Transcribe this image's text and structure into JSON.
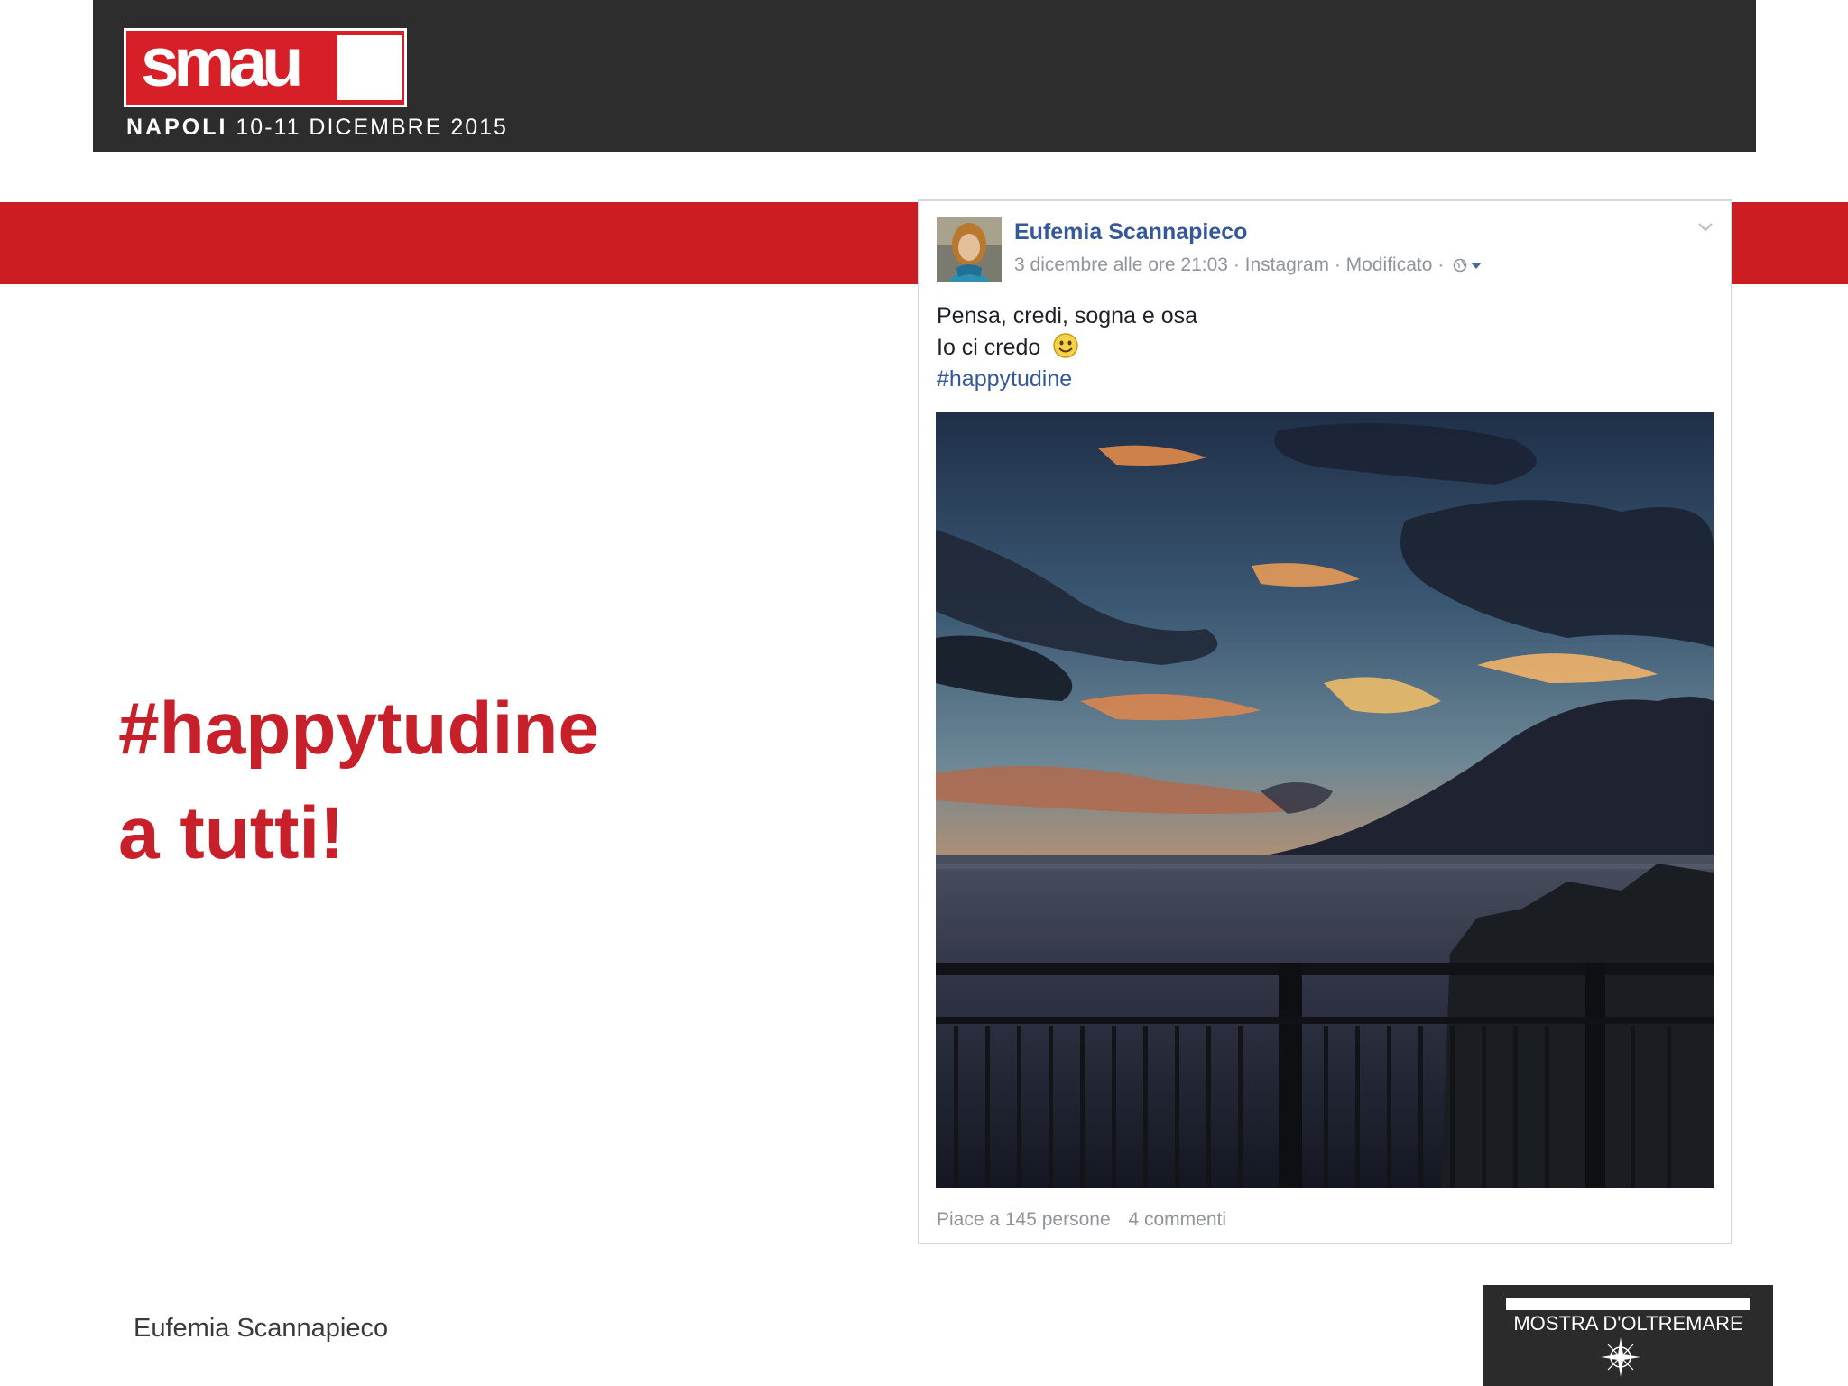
{
  "header": {
    "logo_text": "smau",
    "event_city": "NAPOLI",
    "event_dates": "10-11 DICEMBRE 2015"
  },
  "slide": {
    "title_line1": "#happytudine",
    "title_line2": "a tutti!",
    "footer_author": "Eufemia Scannapieco"
  },
  "post": {
    "author": "Eufemia Scannapieco",
    "meta": "3 dicembre alle ore 21:03 · Instagram · Modificato ·",
    "lines": [
      "Pensa, credi, sogna e osa",
      "Io ci credo"
    ],
    "hashtag": "#happytudine",
    "likes": "Piace a 145 persone",
    "comments": "4 commenti"
  },
  "venue_logo": {
    "text": "MOSTRA D'OLTREMARE"
  },
  "colors": {
    "header_bg": "#2d2d2e",
    "brand_red": "#cc1e22",
    "title_red": "#c8202a",
    "facebook_blue": "#365899",
    "meta_gray": "#90949c"
  },
  "icons": [
    "globe-icon",
    "caret-down-icon",
    "chevron-down-icon",
    "smile-icon",
    "compass-rose-icon"
  ]
}
